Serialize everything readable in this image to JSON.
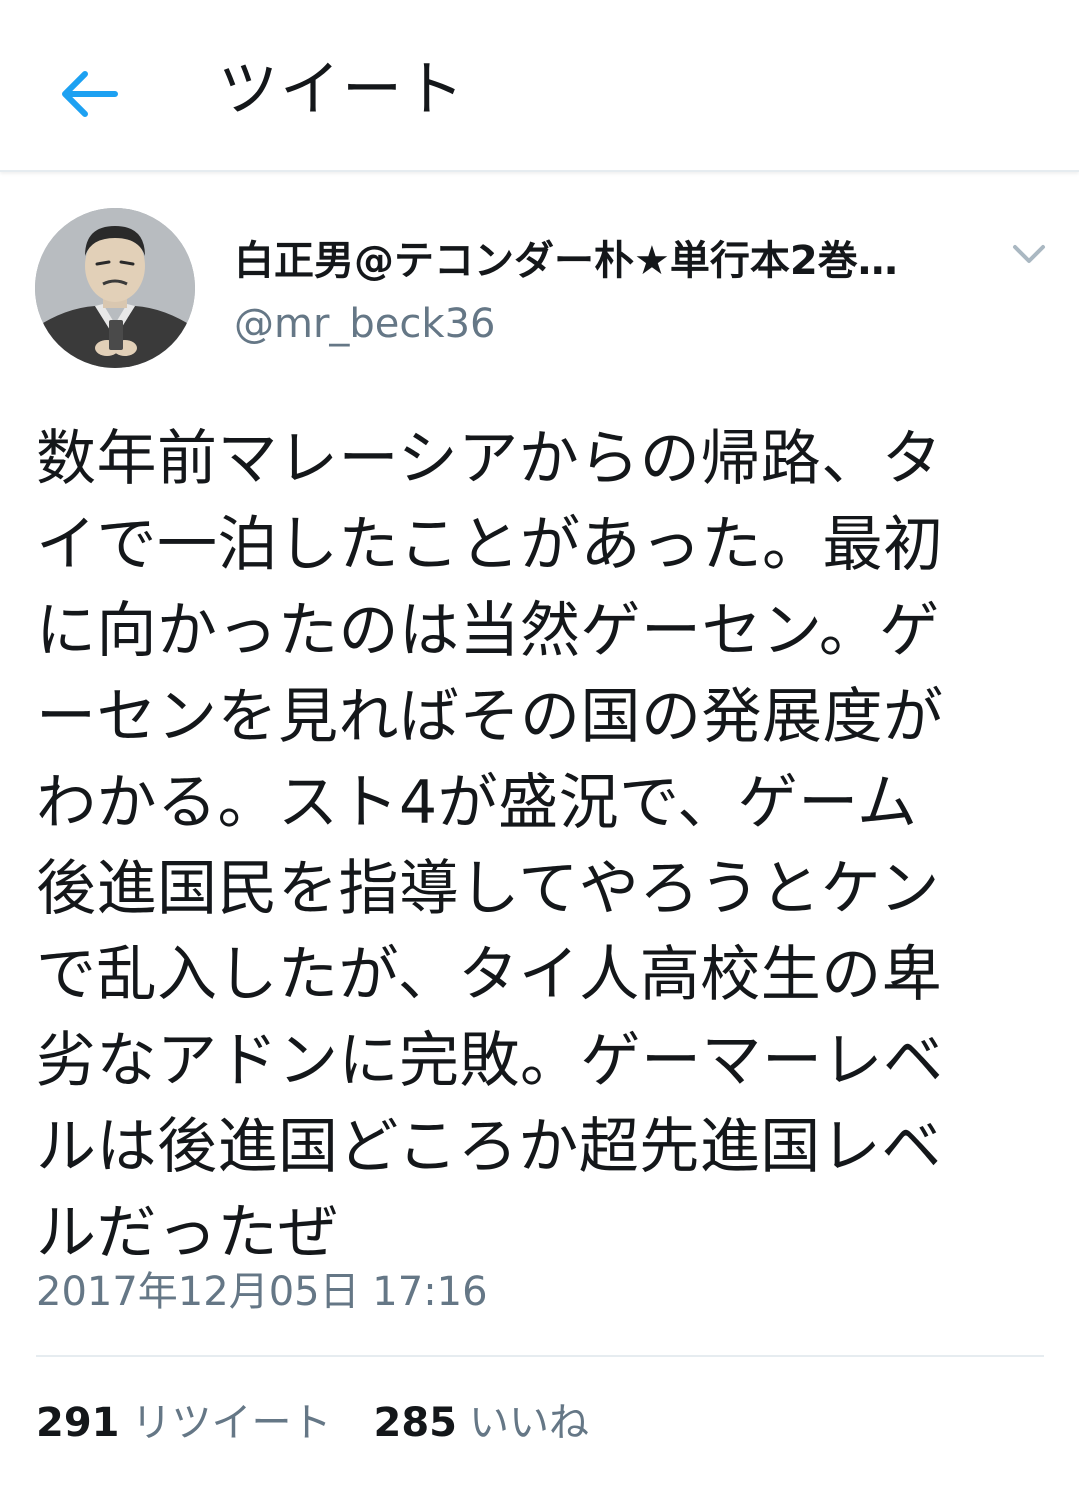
{
  "header": {
    "back_icon": "arrow-left-icon",
    "title": "ツイート",
    "accent_color": "#1da1f2"
  },
  "author": {
    "display_name": "白正男@テコンダー朴★単行本2巻…",
    "handle": "@mr_beck36",
    "avatar_icon": "user-avatar",
    "menu_icon": "chevron-down-icon"
  },
  "tweet": {
    "lines": [
      "数年前マレーシアからの帰路、タ",
      "イで一泊したことがあった。最初",
      "に向かったのは当然ゲーセン。ゲ",
      "ーセンを見ればその国の発展度が",
      "わかる。スト4が盛況で、ゲーム",
      "後進国民を指導してやろうとケン",
      "で乱入したが、タイ人高校生の卑",
      "劣なアドンに完敗。ゲーマーレベ",
      "ルは後進国どころか超先進国レベ",
      "ルだったぜ"
    ],
    "timestamp": "2017年12月05日 17:16"
  },
  "stats": {
    "retweet_count": "291",
    "retweet_label": "リツイート",
    "like_count": "285",
    "like_label": "いいね"
  }
}
